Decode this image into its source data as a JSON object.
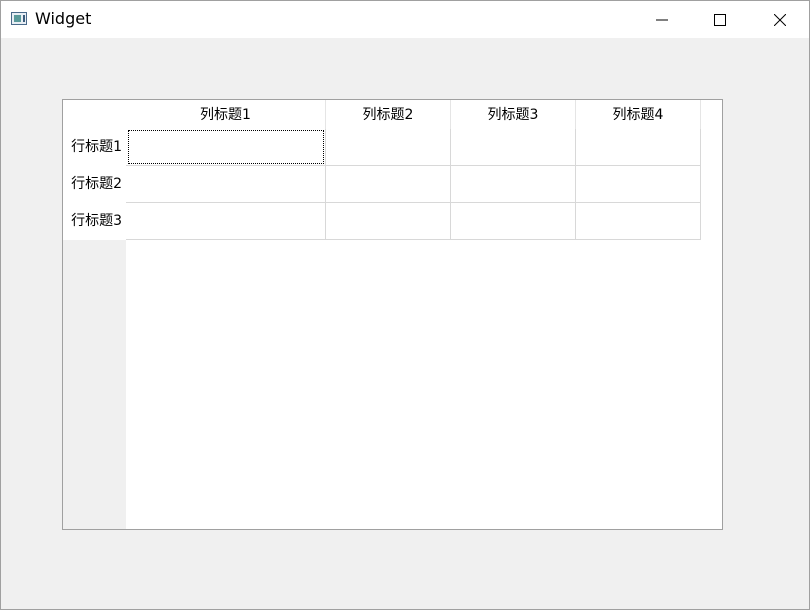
{
  "window": {
    "title": "Widget",
    "icon": "app-window-icon",
    "controls": {
      "minimize": "minimize-icon",
      "maximize": "maximize-icon",
      "close": "close-icon"
    }
  },
  "table": {
    "column_headers": [
      "列标题1",
      "列标题2",
      "列标题3",
      "列标题4"
    ],
    "row_headers": [
      "行标题1",
      "行标题2",
      "行标题3"
    ],
    "cells": [
      [
        "",
        "",
        "",
        ""
      ],
      [
        "",
        "",
        "",
        ""
      ],
      [
        "",
        "",
        "",
        ""
      ]
    ],
    "current_cell": [
      0,
      0
    ]
  }
}
